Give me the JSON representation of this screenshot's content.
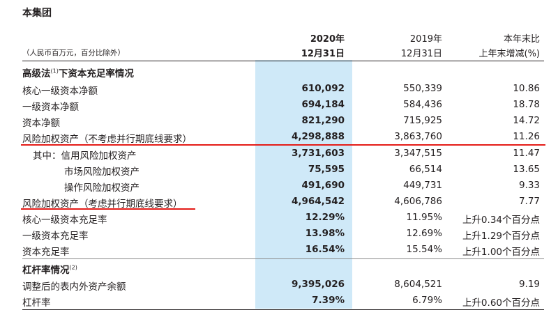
{
  "title": "本集团",
  "header": {
    "col_2020_year": "2020年",
    "col_2020_date": "12月31日",
    "col_2019_year": "2019年",
    "col_2019_date": "12月31日",
    "col_change_line1": "本年末比",
    "col_change_line2": "上年末增减(%)",
    "unit_note": "（人民币百万元，百分比除外）"
  },
  "sections": {
    "advanced": {
      "label": "高级法",
      "sup": "(1)",
      "label_suffix": "下资本充足率情况"
    },
    "leverage": {
      "label": "杠杆率情况",
      "sup": "(2)"
    }
  },
  "rows": [
    {
      "label": "核心一级资本净额",
      "v2020": "610,092",
      "v2019": "550,339",
      "change": "10.86"
    },
    {
      "label": "一级资本净额",
      "v2020": "694,184",
      "v2019": "584,436",
      "change": "18.78"
    },
    {
      "label": "资本净额",
      "v2020": "821,290",
      "v2019": "715,925",
      "change": "14.72"
    },
    {
      "label": "风险加权资产（不考虑并行期底线要求）",
      "v2020": "4,298,888",
      "v2019": "3,863,760",
      "change": "11.26"
    },
    {
      "label": "其中：信用风险加权资产",
      "v2020": "3,731,603",
      "v2019": "3,347,515",
      "change": "11.47"
    },
    {
      "label": "市场风险加权资产",
      "v2020": "75,595",
      "v2019": "66,514",
      "change": "13.65"
    },
    {
      "label": "操作风险加权资产",
      "v2020": "491,690",
      "v2019": "449,731",
      "change": "9.33"
    },
    {
      "label": "风险加权资产（考虑并行期底线要求）",
      "v2020": "4,964,542",
      "v2019": "4,606,786",
      "change": "7.77"
    },
    {
      "label": "核心一级资本充足率",
      "v2020": "12.29%",
      "v2019": "11.95%",
      "change": "上升0.34个百分点"
    },
    {
      "label": "一级资本充足率",
      "v2020": "13.98%",
      "v2019": "12.69%",
      "change": "上升1.29个百分点"
    },
    {
      "label": "资本充足率",
      "v2020": "16.54%",
      "v2019": "15.54%",
      "change": "上升1.00个百分点"
    },
    {
      "label": "调整后的表内外资产余额",
      "v2020": "9,395,026",
      "v2019": "8,604,521",
      "change": "9.19"
    },
    {
      "label": "杠杆率",
      "v2020": "7.39%",
      "v2019": "6.79%",
      "change": "上升0.60个百分点"
    }
  ]
}
